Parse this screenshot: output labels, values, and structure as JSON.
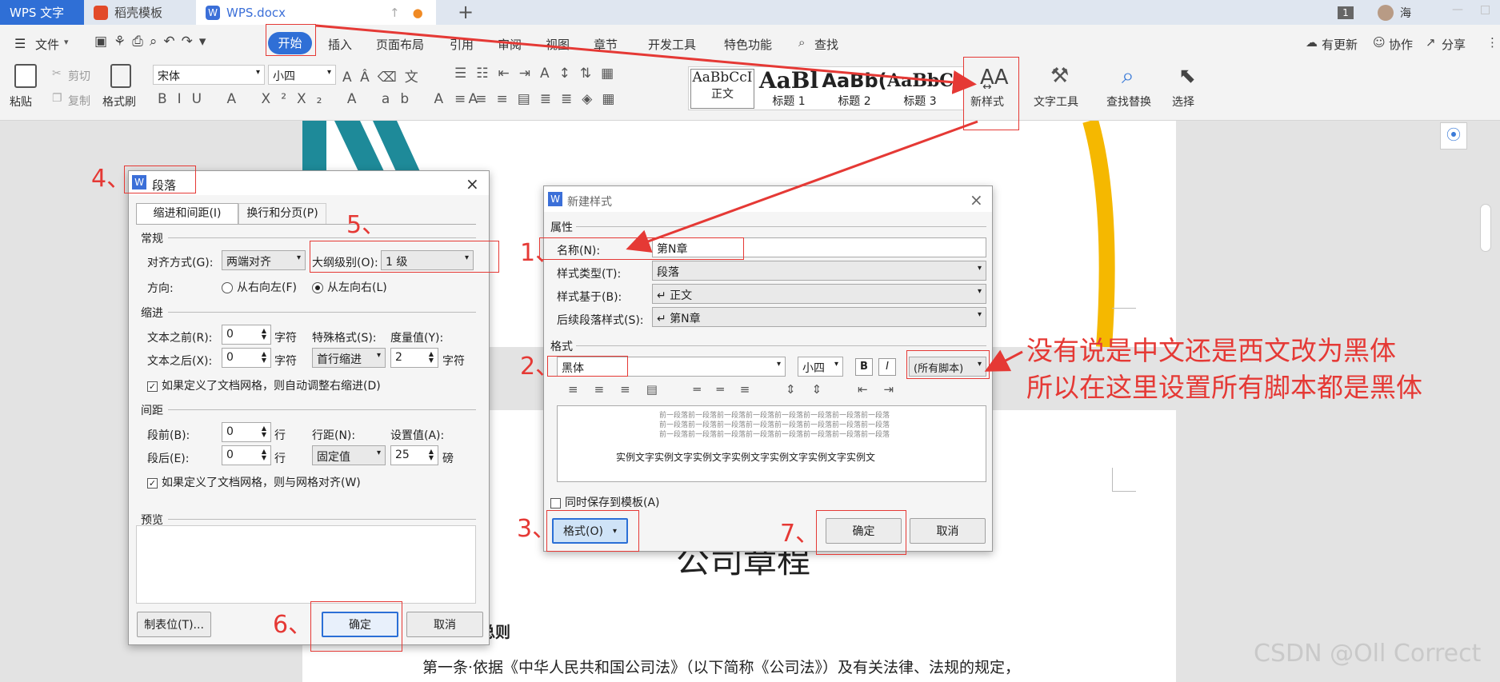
{
  "tabs": [
    {
      "label": "WPS 文字"
    },
    {
      "label": "稻壳模板"
    },
    {
      "label": "WPS.docx"
    }
  ],
  "title_right": {
    "badge": "1",
    "user": "海"
  },
  "menu": {
    "file": "文件",
    "items": [
      "开始",
      "插入",
      "页面布局",
      "引用",
      "审阅",
      "视图",
      "章节",
      "开发工具",
      "特色功能"
    ],
    "search": "查找",
    "update": "有更新",
    "collab": "协作",
    "share": "分享"
  },
  "ribbon": {
    "paste": "粘贴",
    "cut": "剪切",
    "copy": "复制",
    "format_painter": "格式刷",
    "font": "宋体",
    "size": "小四",
    "styles": [
      {
        "sample": "AaBbCcI",
        "name": "正文"
      },
      {
        "sample": "AaBl",
        "name": "标题 1"
      },
      {
        "sample": "AaBb(",
        "name": "标题 2"
      },
      {
        "sample": "AaBbC",
        "name": "标题 3"
      }
    ],
    "new_style": "新样式",
    "text_tools": "文字工具",
    "find_replace": "查找替换",
    "select": "选择"
  },
  "para_dialog": {
    "title": "段落",
    "tab1": "缩进和间距(I)",
    "tab2": "换行和分页(P)",
    "general": "常规",
    "align_label": "对齐方式(G):",
    "align_value": "两端对齐",
    "outline_label": "大纲级别(O):",
    "outline_value": "1 级",
    "direction_label": "方向:",
    "rtl": "从右向左(F)",
    "ltr": "从左向右(L)",
    "indent": "缩进",
    "before_text": "文本之前(R):",
    "before_text_val": "0",
    "after_text": "文本之后(X):",
    "after_text_val": "0",
    "unit_char": "字符",
    "special": "特殊格式(S):",
    "special_val": "首行缩进",
    "measure": "度量值(Y):",
    "measure_val": "2",
    "grid_indent": "如果定义了文档网格，则自动调整右缩进(D)",
    "spacing": "间距",
    "before": "段前(B):",
    "before_val": "0",
    "after": "段后(E):",
    "after_val": "0",
    "unit_line": "行",
    "line_spacing": "行距(N):",
    "line_spacing_val": "固定值",
    "setting": "设置值(A):",
    "setting_val": "25",
    "unit_pt": "磅",
    "grid_align": "如果定义了文档网格，则与网格对齐(W)",
    "preview": "预览",
    "tabs_btn": "制表位(T)...",
    "ok": "确定",
    "cancel": "取消"
  },
  "style_dialog": {
    "title": "新建样式",
    "props": "属性",
    "name_label": "名称(N):",
    "name_value": "第N章",
    "type_label": "样式类型(T):",
    "type_value": "段落",
    "based_label": "样式基于(B):",
    "based_value": "↵ 正文",
    "next_label": "后续段落样式(S):",
    "next_value": "↵ 第N章",
    "format": "格式",
    "font": "黑体",
    "size": "小四",
    "script": "(所有脚本)",
    "preview_prev": "前一段落前一段落前一段落前一段落前一段落前一段落前一段落前一段落",
    "preview_sample": "实例文字实例文字实例文字实例文字实例文字实例文字实例文",
    "save_template": "同时保存到模板(A)",
    "format_btn": "格式(O)",
    "ok": "确定",
    "cancel": "取消"
  },
  "annotations": {
    "n1": "1、",
    "n2": "2、",
    "n3": "3、",
    "n4": "4、",
    "n5": "5、",
    "n6": "6、",
    "n7": "7、",
    "note1": "没有说是中文还是西文改为黑体",
    "note2": "所以在这里设置所有脚本都是黑体"
  },
  "document": {
    "title": "公司章程",
    "chapter": "总则",
    "article": "第一条·依据《中华人民共和国公司法》（以下简称《公司法》）及有关法律、法规的规定，"
  },
  "watermark": "CSDN @Oll Correct",
  "colors": {
    "accent": "#2b6fd6",
    "annotation": "#e53935",
    "teal": "#1e8a99",
    "yellow": "#f5b800"
  }
}
